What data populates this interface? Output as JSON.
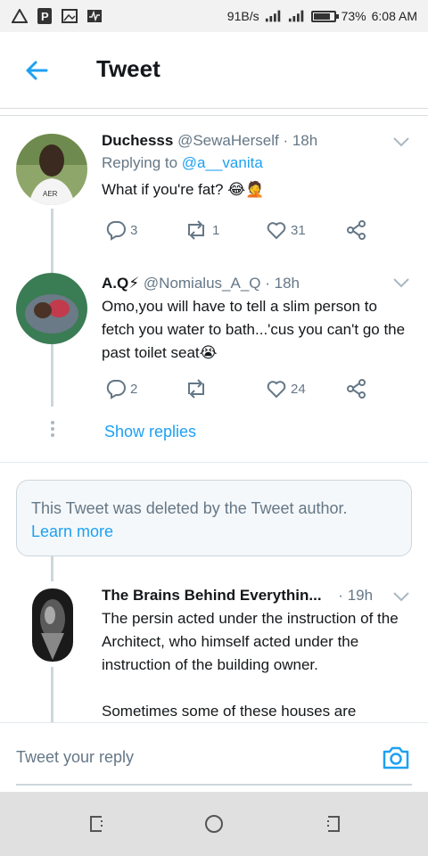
{
  "status_bar": {
    "net_speed": "91B/s",
    "battery_percent": "73%",
    "battery_level": 0.73,
    "time": "6:08 AM"
  },
  "header": {
    "title": "Tweet"
  },
  "tweets": [
    {
      "name": "Duchesss",
      "handle": "@SewaHerself",
      "time": "18h",
      "replying_label": "Replying to",
      "replying_to": "@a__vanita",
      "text": "What if you're fat? 😂🤦",
      "replies": "3",
      "retweets": "1",
      "likes": "31"
    },
    {
      "name": "A.Q⚡",
      "handle": "@Nomialus_A_Q",
      "time": "18h",
      "text": "Omo,you will have to tell a slim person to fetch you water to bath...'cus you can't go the past toilet seat😭",
      "replies": "2",
      "retweets": "",
      "likes": "24"
    },
    {
      "name": "The Brains Behind Everythin...",
      "handle": "",
      "time": "19h",
      "text_1": "The persin acted under the instruction of the Architect, who himself acted under the instruction of the building owner.",
      "text_2": "Sometimes some of these houses are"
    }
  ],
  "show_replies": "Show replies",
  "deleted_notice": {
    "text": "This Tweet was deleted by the Tweet author.",
    "link": "Learn more"
  },
  "reply_bar": {
    "placeholder": "Tweet your reply"
  },
  "colors": {
    "accent": "#1da1f2",
    "muted": "#657786",
    "border": "#e1e8ed"
  }
}
